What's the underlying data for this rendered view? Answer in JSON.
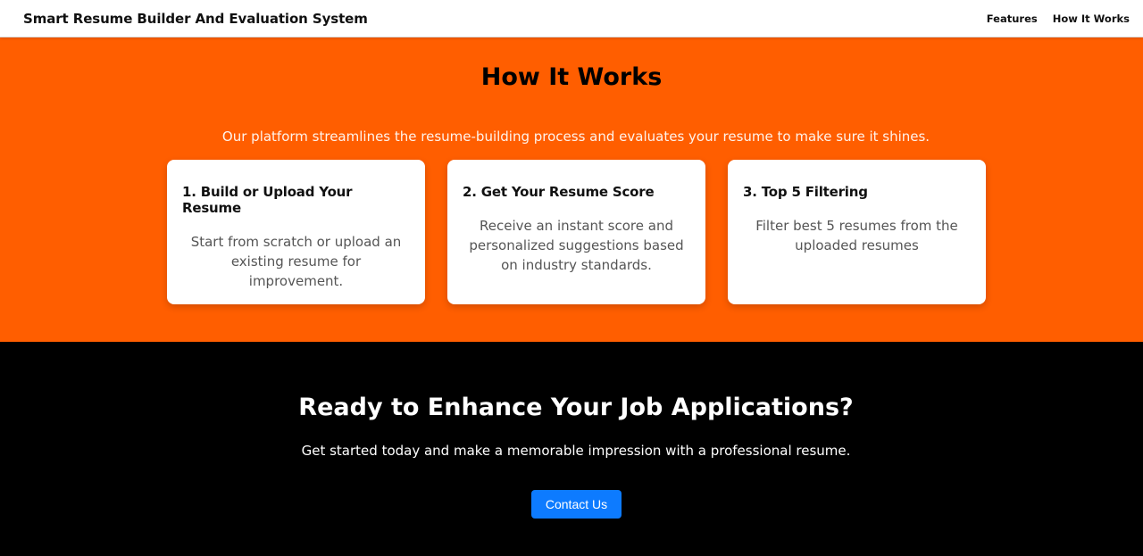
{
  "colors": {
    "accent": "#ff5e00",
    "cta_background": "#000000",
    "button": "#0d7bff"
  },
  "navbar": {
    "brand": "Smart Resume Builder And Evaluation System",
    "links": [
      {
        "label": "Features"
      },
      {
        "label": "How It Works"
      }
    ]
  },
  "how_it_works": {
    "title": "How It Works",
    "subtitle": "Our platform streamlines the resume-building process and evaluates your resume to make sure it shines.",
    "cards": [
      {
        "title": "1. Build or Upload Your Resume",
        "text": "Start from scratch or upload an existing resume for improvement."
      },
      {
        "title": "2. Get Your Resume Score",
        "text": "Receive an instant score and personalized suggestions based on industry standards."
      },
      {
        "title": "3. Top 5 Filtering",
        "text": "Filter best 5 resumes from the uploaded resumes"
      }
    ]
  },
  "cta": {
    "title": "Ready to Enhance Your Job Applications?",
    "text": "Get started today and make a memorable impression with a professional resume.",
    "button_label": "Contact Us"
  }
}
